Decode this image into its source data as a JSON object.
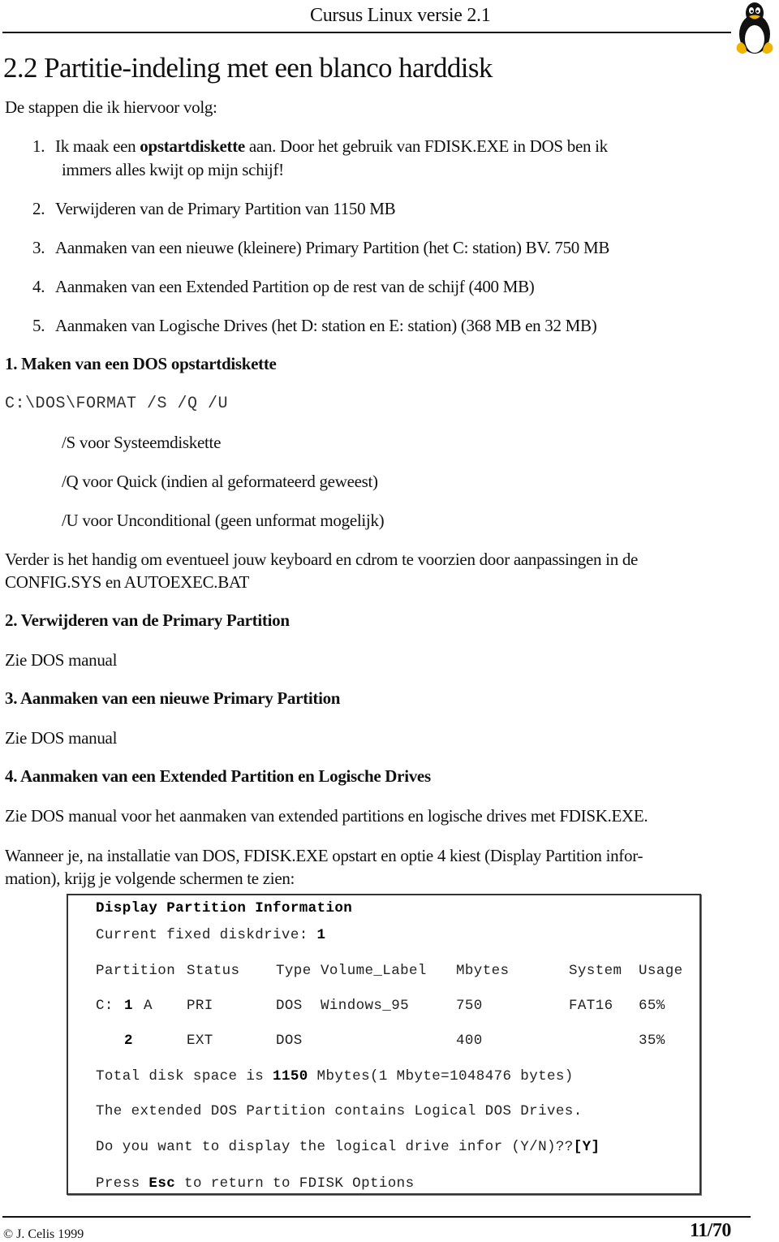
{
  "header": {
    "title": "Cursus Linux versie 2.1",
    "logo_icon": "tux-penguin-icon"
  },
  "section": {
    "title": "2.2 Partitie-indeling met een blanco harddisk",
    "intro": "De stappen die ik hiervoor volg:"
  },
  "steps": [
    {
      "num": "1.",
      "pre": "Ik maak een ",
      "bold": "opstartdiskette",
      "post": " aan. Door het gebruik van FDISK.EXE in DOS ben ik",
      "cont": "immers alles kwijt op mijn schijf!"
    },
    {
      "num": "2.",
      "text": "Verwijderen van de Primary Partition van 1150 MB"
    },
    {
      "num": "3.",
      "text": "Aanmaken van een nieuwe (kleinere) Primary Partition (het C: station) BV. 750 MB"
    },
    {
      "num": "4.",
      "text": "Aanmaken van een Extended Partition op de rest van de schijf (400 MB)"
    },
    {
      "num": "5.",
      "text": "Aanmaken van Logische Drives (het D: station en E: station) (368 MB en 32 MB)"
    }
  ],
  "sub1": {
    "heading": "1. Maken van een DOS opstartdiskette",
    "command": "C:\\DOS\\FORMAT /S /Q /U",
    "options": [
      "/S voor Systeemdiskette",
      "/Q voor Quick (indien al geformateerd geweest)",
      "/U voor Unconditional (geen unformat mogelijk)"
    ],
    "note_line1": "Verder is het handig om eventueel jouw keyboard en cdrom te voorzien door aanpassingen in de",
    "note_line2": "CONFIG.SYS en AUTOEXEC.BAT"
  },
  "sub2": {
    "heading": "2. Verwijderen van de Primary Partition",
    "text": "Zie DOS manual"
  },
  "sub3": {
    "heading": "3. Aanmaken van een nieuwe Primary Partition",
    "text": "Zie DOS manual"
  },
  "sub4": {
    "heading": "4. Aanmaken van een Extended Partition en Logische Drives",
    "text": "Zie DOS manual voor het aanmaken van extended partitions en logische drives met FDISK.EXE.",
    "para_line1": "Wanneer je, na installatie van DOS, FDISK.EXE opstart en optie 4 kiest (Display Partition infor-",
    "para_line2": "mation), krijg je volgende schermen te zien:"
  },
  "terminal": {
    "title": "Display Partition Information",
    "drive_label": "Current fixed diskdrive: ",
    "drive_value": "1",
    "columns": [
      "Partition",
      "Status",
      "Type",
      "Volume_Label",
      "Mbytes",
      "System",
      "Usage"
    ],
    "rows": [
      {
        "drive": "C:",
        "partition": "1",
        "status_flag": "A",
        "status": "PRI",
        "type": "DOS",
        "volume_label": "Windows_95",
        "mbytes": "750",
        "system": "FAT16",
        "usage": "65%"
      },
      {
        "drive": "",
        "partition": "2",
        "status_flag": "",
        "status": "EXT",
        "type": "DOS",
        "volume_label": "",
        "mbytes": "400",
        "system": "",
        "usage": "35%"
      }
    ],
    "total_pre": "Total disk space is ",
    "total_value": "1150",
    "total_post": " Mbytes(1 Mbyte=1048476 bytes)",
    "extended_msg": "The extended DOS Partition contains Logical DOS Drives.",
    "prompt": "Do you want to display the logical drive infor (Y/N)??",
    "prompt_answer": "[Y]",
    "esc_pre": "Press ",
    "esc_key": "Esc",
    "esc_post": " to return to FDISK Options"
  },
  "footer": {
    "copyright": "© J. Celis 1999",
    "page": "11/70"
  }
}
